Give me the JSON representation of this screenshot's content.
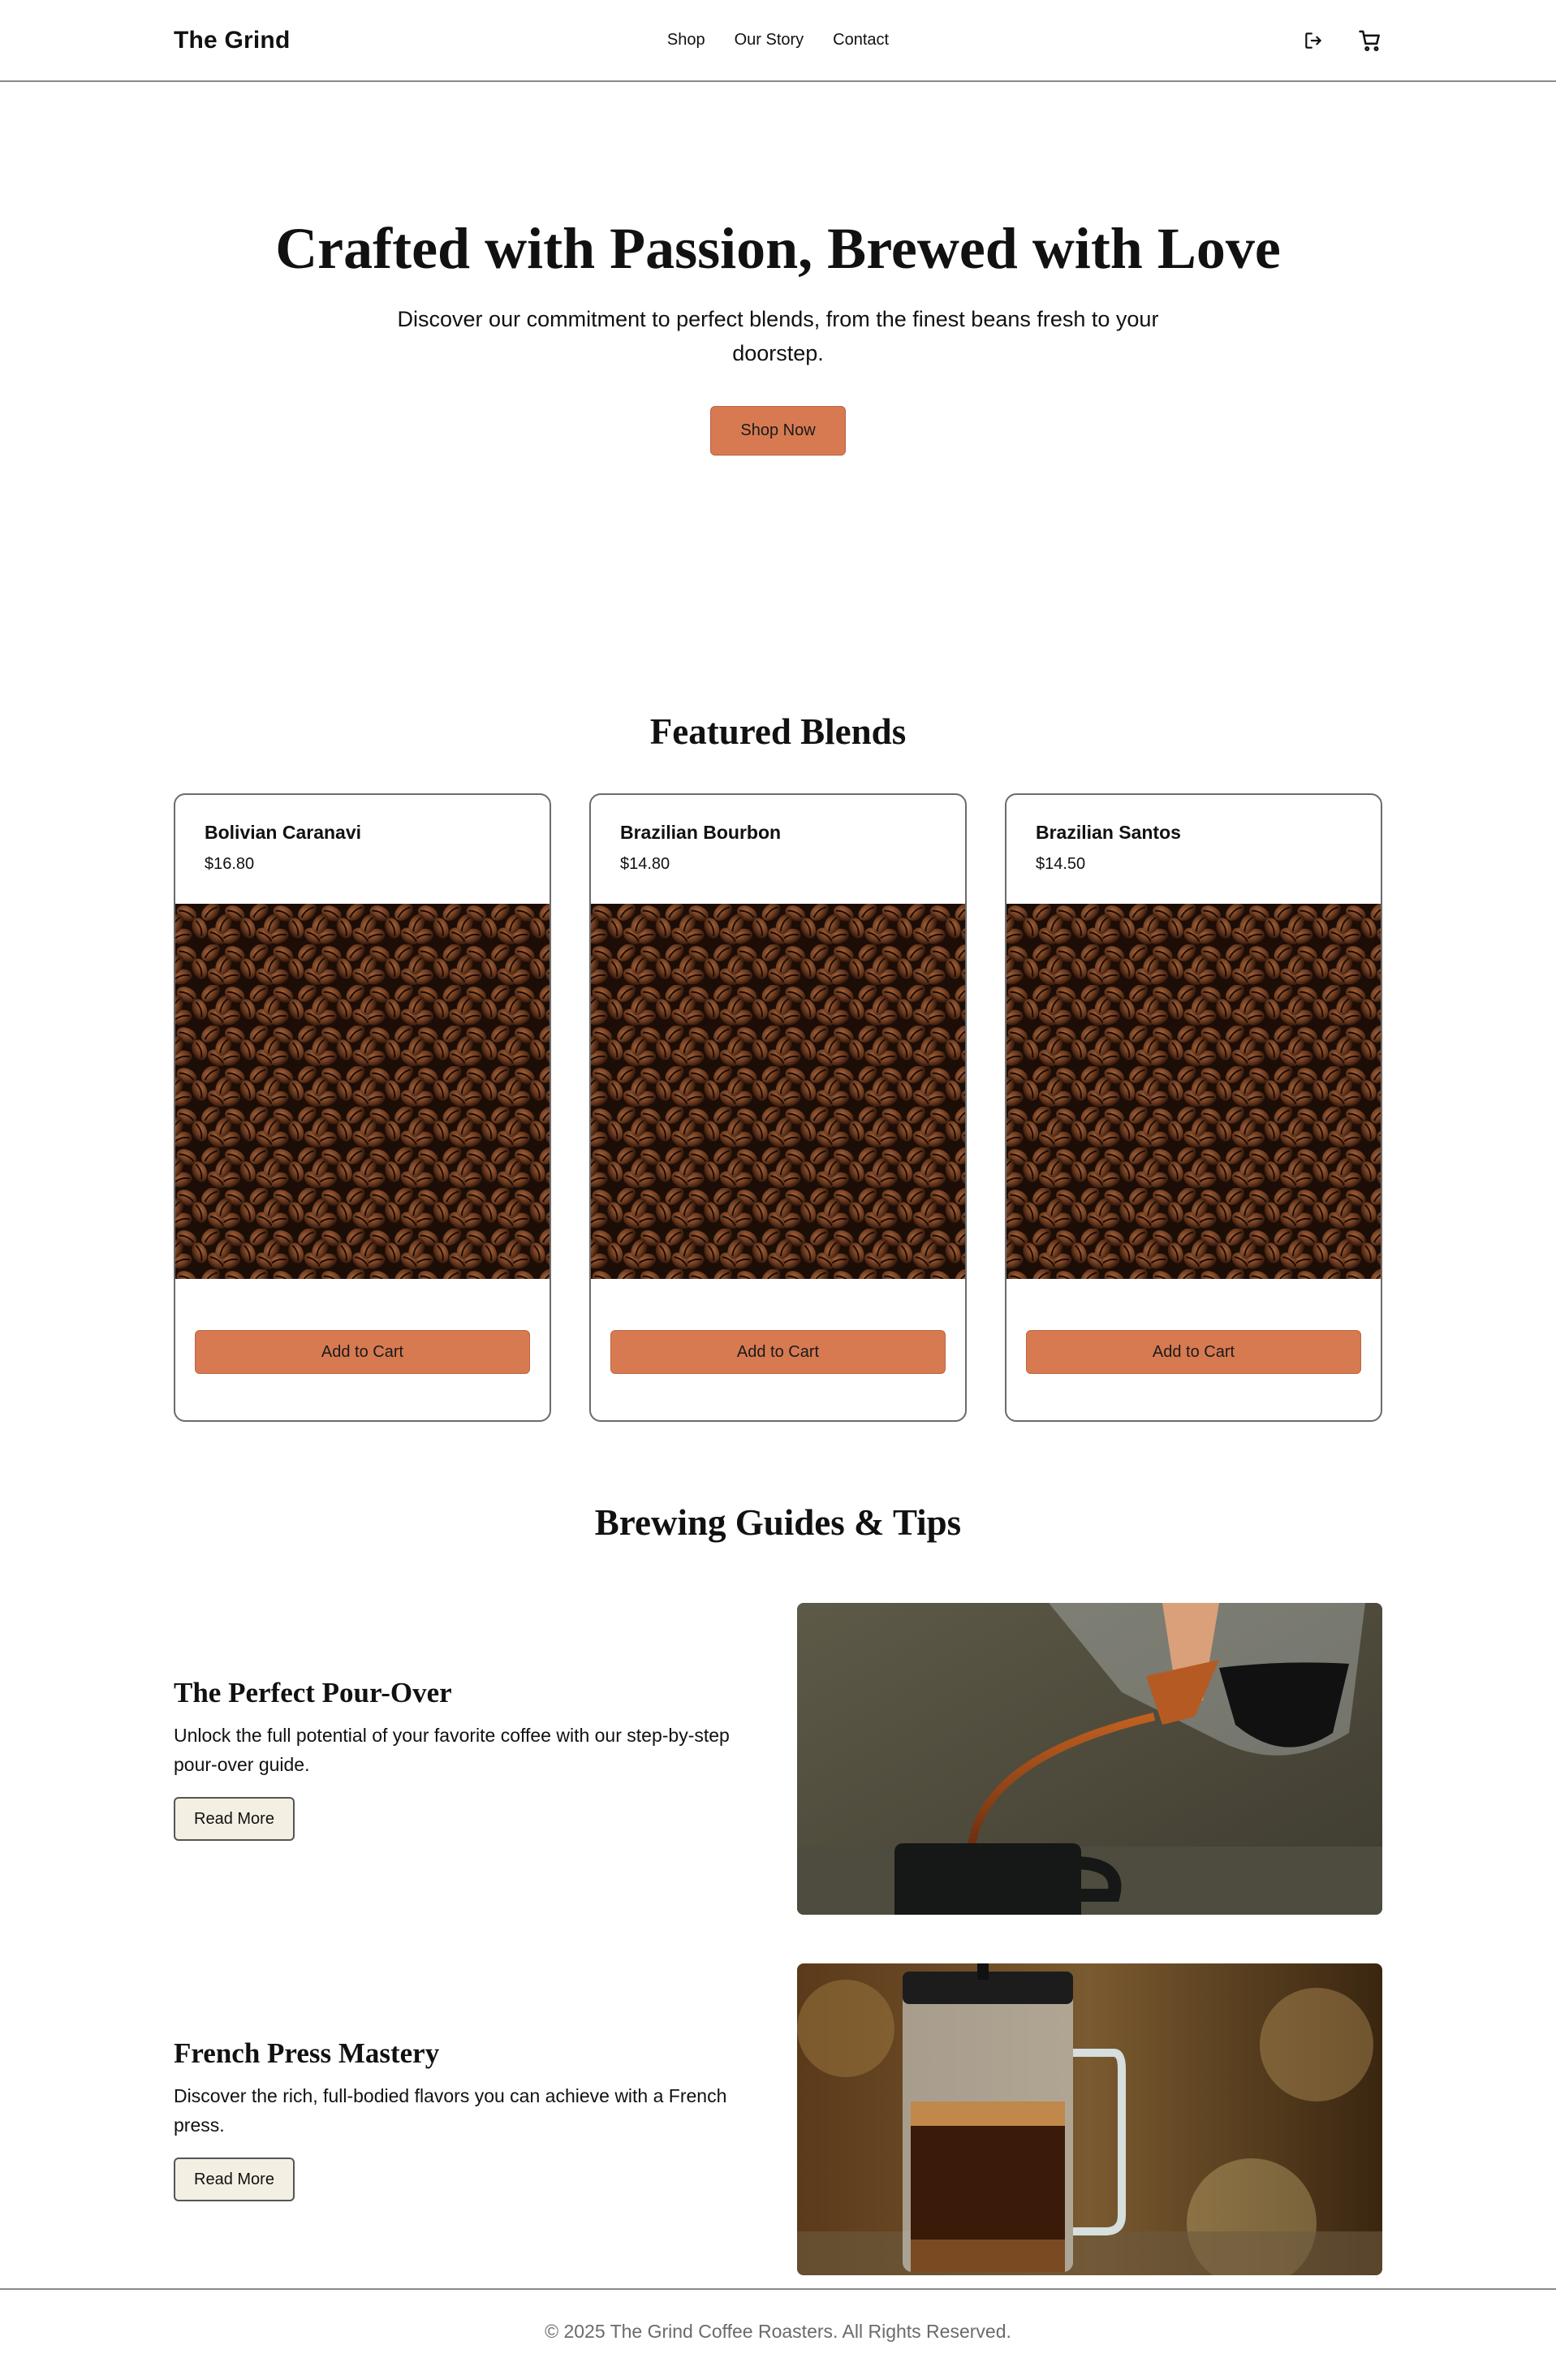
{
  "header": {
    "logo": "The Grind",
    "nav": [
      "Shop",
      "Our Story",
      "Contact"
    ],
    "icons": [
      "logout-icon",
      "cart-icon"
    ]
  },
  "hero": {
    "title": "Crafted with Passion, Brewed with Love",
    "subtitle": "Discover our commitment to perfect blends, from the finest beans fresh to your doorstep.",
    "cta": "Shop Now"
  },
  "featured": {
    "title": "Featured Blends",
    "products": [
      {
        "name": "Bolivian Caranavi",
        "price": "$16.80",
        "button": "Add to Cart"
      },
      {
        "name": "Brazilian Bourbon",
        "price": "$14.80",
        "button": "Add to Cart"
      },
      {
        "name": "Brazilian Santos",
        "price": "$14.50",
        "button": "Add to Cart"
      }
    ]
  },
  "guides": {
    "title": "Brewing Guides & Tips",
    "items": [
      {
        "title": "The Perfect Pour-Over",
        "text": "Unlock the full potential of your favorite coffee with our step-by-step pour-over guide.",
        "button": "Read More"
      },
      {
        "title": "French Press Mastery",
        "text": "Discover the rich, full-bodied flavors you can achieve with a French press.",
        "button": "Read More"
      }
    ]
  },
  "footer": {
    "copyright": "© 2025 The Grind Coffee Roasters. All Rights Reserved."
  },
  "colors": {
    "accent": "#d77a52",
    "outline_button_bg": "#f4efe3",
    "footer_text": "#6b6b6b"
  }
}
